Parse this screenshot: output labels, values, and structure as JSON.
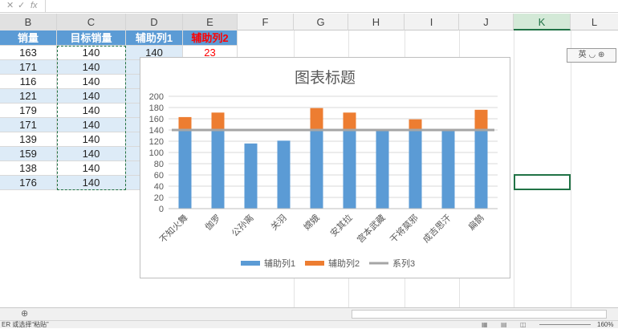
{
  "formula_bar": {
    "icons": [
      "cancel-icon",
      "enter-icon",
      "function-icon"
    ],
    "cancel_glyph": "✕",
    "enter_glyph": "✓",
    "fx_label": "fx"
  },
  "columns": [
    "B",
    "C",
    "D",
    "E",
    "F",
    "G",
    "H",
    "I",
    "J",
    "K",
    "L"
  ],
  "table": {
    "headers": [
      "销量",
      "目标销量",
      "辅助列1",
      "辅助列2"
    ],
    "rows": [
      [
        "163",
        "140",
        "140",
        "23"
      ],
      [
        "171",
        "140",
        "",
        ""
      ],
      [
        "116",
        "140",
        "",
        ""
      ],
      [
        "121",
        "140",
        "",
        ""
      ],
      [
        "179",
        "140",
        "",
        ""
      ],
      [
        "171",
        "140",
        "",
        ""
      ],
      [
        "139",
        "140",
        "",
        ""
      ],
      [
        "159",
        "140",
        "",
        ""
      ],
      [
        "138",
        "140",
        "",
        ""
      ],
      [
        "176",
        "140",
        "",
        ""
      ]
    ]
  },
  "ime_toolbar": "英 ◡ ⊕",
  "status": {
    "left_text": "ER 或选择“粘贴”",
    "zoom": "160%"
  },
  "colors": {
    "header_fill": "#5b9bd5",
    "band_fill": "#ddebf7",
    "series1": "#5b9bd5",
    "series2": "#ed7d31",
    "series3": "#a5a5a5",
    "accent": "#217346"
  },
  "chart_data": {
    "type": "bar",
    "title": "图表标题",
    "categories": [
      "不知火舞",
      "伽罗",
      "公孙离",
      "关羽",
      "嫦娥",
      "安其拉",
      "宫本武藏",
      "干将莫邪",
      "成吉思汗",
      "扁鹊"
    ],
    "series": [
      {
        "name": "辅助列1",
        "type": "bar",
        "values": [
          140,
          140,
          116,
          121,
          140,
          140,
          139,
          140,
          138,
          140
        ]
      },
      {
        "name": "辅助列2",
        "type": "bar",
        "values": [
          23,
          31,
          0,
          0,
          39,
          31,
          0,
          19,
          0,
          36
        ]
      },
      {
        "name": "系列3",
        "type": "line",
        "values": [
          140,
          140,
          140,
          140,
          140,
          140,
          140,
          140,
          140,
          140
        ]
      }
    ],
    "stacked": true,
    "ylim": [
      0,
      200
    ],
    "yticks": [
      "0",
      "20",
      "40",
      "60",
      "80",
      "100",
      "120",
      "140",
      "160",
      "180",
      "200"
    ],
    "grid": true,
    "legend_position": "bottom"
  }
}
